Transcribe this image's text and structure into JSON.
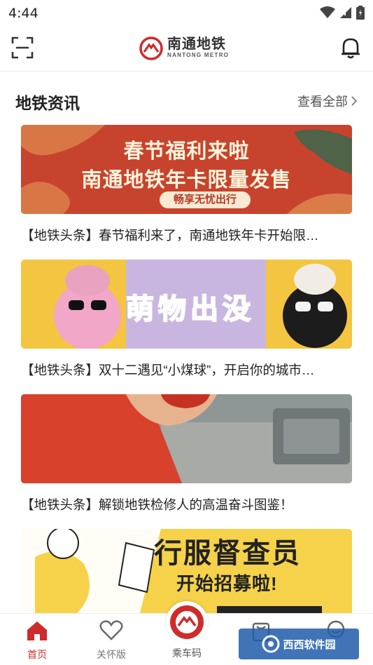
{
  "status": {
    "time": "4:44"
  },
  "header": {
    "logo_cn": "南通地铁",
    "logo_en": "NANTONG METRO"
  },
  "section": {
    "title": "地铁资讯",
    "more": "查看全部"
  },
  "news": [
    {
      "banner_line1": "春节福利来啦",
      "banner_line2": "南通地铁年卡限量发售",
      "banner_pill": "畅享无忧出行",
      "caption": "【地铁头条】春节福利来了，南通地铁年卡开始限…"
    },
    {
      "banner_words": [
        "萌",
        "物",
        "出",
        "没"
      ],
      "caption": "【地铁头条】双十二遇见“小煤球”，开启你的城市…"
    },
    {
      "caption": "【地铁头条】解锁地铁检修人的高温奋斗图鉴！"
    },
    {
      "banner_line1": "行服督查员",
      "banner_line2": "开始招募啦!"
    }
  ],
  "tabs": {
    "home": "首页",
    "care": "关怀版",
    "ride": "乘车码"
  },
  "watermark": "西西软件园",
  "colors": {
    "brand_red": "#d02b2b",
    "banner1_bg": "#c8432d",
    "banner2_bg": "#f4c540",
    "banner4_bg": "#f6d24a"
  }
}
